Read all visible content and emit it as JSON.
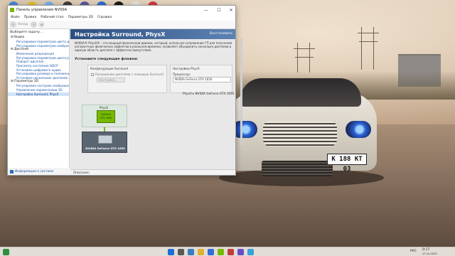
{
  "window": {
    "title": "Панель управления NVIDIA",
    "minimize": "—",
    "maximize": "☐",
    "close": "✕"
  },
  "menu": [
    "Файл",
    "Правка",
    "Рабочий стол",
    "Параметры 3D",
    "Справка"
  ],
  "toolbar": {
    "back_label": "Назад",
    "back_glyph": "‹",
    "forward_glyph": "›",
    "home_glyph": "⌂"
  },
  "sidebar": {
    "header": "Выберите задачу...",
    "tree": [
      {
        "type": "cat",
        "label": "⊟ Видео"
      },
      {
        "type": "item",
        "label": "Регулировка параметров цвета для видео"
      },
      {
        "type": "item",
        "label": "Регулировка параметров изображения для видео"
      },
      {
        "type": "cat",
        "label": "⊟ Дисплей"
      },
      {
        "type": "item",
        "label": "Изменение разрешения"
      },
      {
        "type": "item",
        "label": "Регулировка параметров цвета рабочего стола"
      },
      {
        "type": "item",
        "label": "Поворот дисплея"
      },
      {
        "type": "item",
        "label": "Просмотр состояния HDCP"
      },
      {
        "type": "item",
        "label": "Установка цифрового аудио"
      },
      {
        "type": "item",
        "label": "Регулировка размера и положения рабочего стола"
      },
      {
        "type": "item",
        "label": "Установка нескольких дисплеев"
      },
      {
        "type": "cat",
        "label": "⊟ Параметры 3D"
      },
      {
        "type": "item",
        "label": "Регулировка настроек изображения с просмотром"
      },
      {
        "type": "item",
        "label": "Управление параметрами 3D"
      },
      {
        "type": "item",
        "label": "Настройка Surround, PhysX",
        "selected": true
      }
    ],
    "system_info": "Информация о системе"
  },
  "main": {
    "title": "Настройка Surround, PhysX",
    "restore": "Восстановить",
    "description": "NVIDIA® PhysX® – это мощный физический движок, который, используя сопряжение ГП для получения когерентных физических эффектов в реальном времени, позволяет объединить несколько дисплеев в единую область дисплея с эффектом присутствия.",
    "section": "Установите следующие флажки:",
    "surround": {
      "title": "Конфигурация Surround",
      "checkbox": "Расширение дисплеев с помощью Surround",
      "button": "Настройка..."
    },
    "physx": {
      "title": "Настройки PhysX",
      "processor_label": "Процессор:",
      "processor_value": "NVIDIA GeForce GTX 1650",
      "mapping": "PhysX ▸ NVIDIA GeForce GTX 1650"
    },
    "diagram": {
      "top_label": "PhysX",
      "chip_label_1": "GeForce",
      "chip_label_2": "GTX 1650",
      "gpu_label": "NVIDIA GeForce GTX 1650"
    },
    "footer": "Описание:"
  },
  "desktop": {
    "plate": "К 188 КТ 03"
  },
  "tray": {
    "lang": "РУС",
    "time": "0:17",
    "date": "17.12.2023"
  }
}
